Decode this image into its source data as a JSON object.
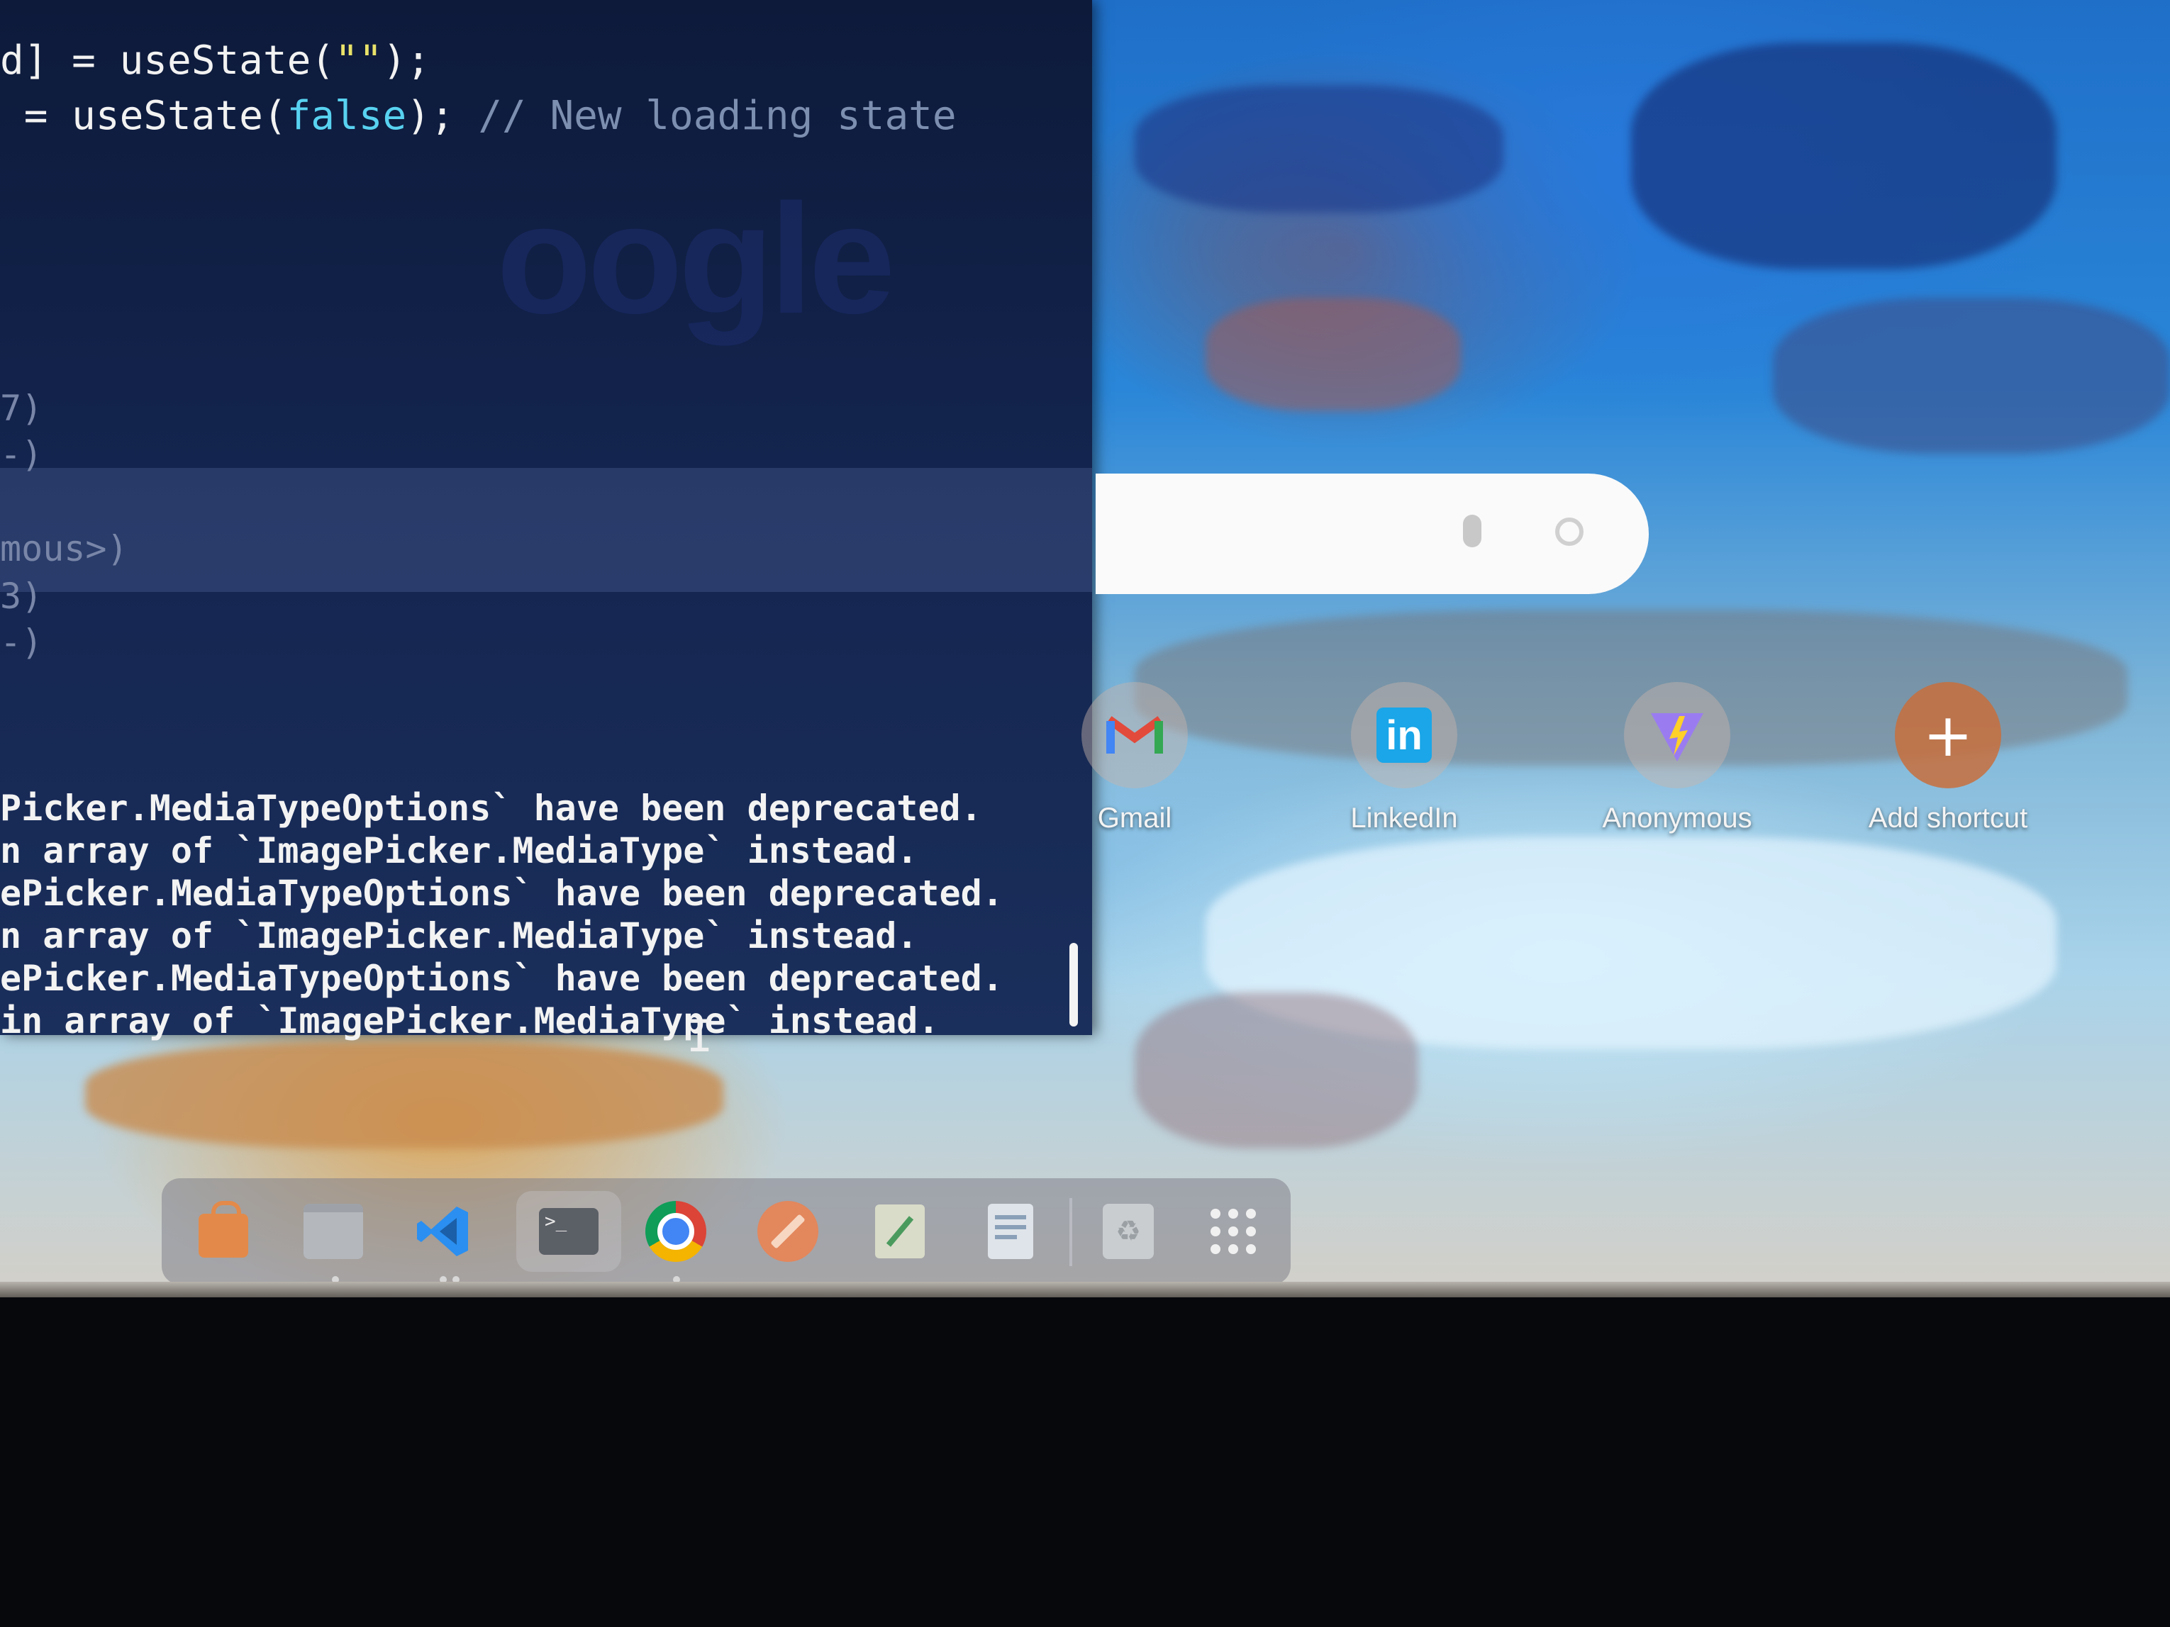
{
  "terminal": {
    "code_lines": [
      {
        "pre": "d] = useState(",
        "str": "\"\"",
        "post": ");"
      },
      {
        "pre": " = useState(",
        "kw": "false",
        "post": ");",
        "comment": "// New loading state"
      }
    ],
    "trace_lines": [
      "7)",
      "-)",
      "mous>)",
      "3)",
      "-)"
    ],
    "log_lines": [
      "Picker.MediaTypeOptions` have been deprecated.",
      "n array of `ImagePicker.MediaType` instead.",
      "ePicker.MediaTypeOptions` have been deprecated.",
      "n array of `ImagePicker.MediaType` instead.",
      "ePicker.MediaTypeOptions` have been deprecated.",
      "in array of `ImagePicker.MediaType` instead."
    ]
  },
  "new_tab": {
    "search_icons": [
      "mic-icon",
      "google-lens-icon"
    ],
    "shortcuts": [
      {
        "label": "Gmail",
        "icon": "gmail-icon"
      },
      {
        "label": "LinkedIn",
        "icon": "linkedin-icon"
      },
      {
        "label": "Anonymous",
        "icon": "vite-icon"
      },
      {
        "label": "Add shortcut",
        "icon": "plus-icon"
      }
    ]
  },
  "dock": {
    "items": [
      {
        "name": "app-center",
        "icon": "shopping-bag-icon"
      },
      {
        "name": "files",
        "icon": "folder-icon"
      },
      {
        "name": "vscode",
        "icon": "vscode-icon"
      },
      {
        "name": "terminal",
        "icon": "terminal-icon"
      },
      {
        "name": "chrome",
        "icon": "chrome-icon"
      },
      {
        "name": "drawing",
        "icon": "pencil-icon"
      },
      {
        "name": "text-editor",
        "icon": "text-editor-icon"
      },
      {
        "name": "document",
        "icon": "document-icon"
      },
      {
        "name": "trash",
        "icon": "trash-icon"
      },
      {
        "name": "show-apps",
        "icon": "app-grid-icon"
      }
    ],
    "colors": {
      "linkedin": "#0a66c2",
      "chrome_red": "#db4437",
      "chrome_yellow": "#f4b400",
      "chrome_green": "#0f9d58",
      "vscode": "#2a8ff0"
    }
  }
}
